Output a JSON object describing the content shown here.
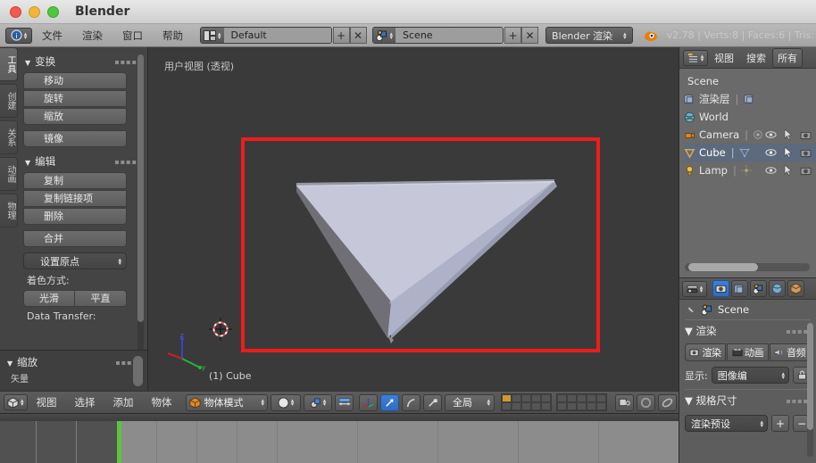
{
  "window": {
    "title": "Blender"
  },
  "topbar": {
    "menus": [
      "文件",
      "渲染",
      "窗口",
      "帮助"
    ],
    "screen_layout": "Default",
    "scene_name": "Scene",
    "engine": "Blender 渲染",
    "status": "v2.78 | Verts:8 | Faces:6 | Tris:",
    "add_label": "+",
    "remove_label": "✕"
  },
  "toolshelf": {
    "tabs": [
      {
        "label": "工具",
        "active": true
      },
      {
        "label": "创建",
        "active": false
      },
      {
        "label": "关系",
        "active": false
      },
      {
        "label": "动画",
        "active": false
      },
      {
        "label": "物理",
        "active": false
      }
    ],
    "panels": [
      {
        "title": "变换",
        "buttons": [
          "移动",
          "旋转",
          "缩放"
        ],
        "extra_buttons": [
          "镜像"
        ]
      },
      {
        "title": "编辑",
        "buttons": [
          "复制",
          "复制链接项",
          "删除"
        ],
        "extra_buttons": [
          "合并"
        ],
        "dropdown": "设置原点",
        "shading_label": "着色方式:",
        "shading_options": [
          "光滑",
          "平直"
        ],
        "data_transfer_label": "Data Transfer:"
      }
    ],
    "scale_panel": {
      "title": "缩放",
      "sub_label": "矢量"
    }
  },
  "viewport": {
    "view_info": "用户视图 (透视)",
    "object_label": "(1) Cube",
    "axis_labels": {
      "z": "z",
      "y": "y",
      "x": "x"
    },
    "annotation_color": "#ee1c1c",
    "background_color": "#3a3a3a",
    "object_color": "#c0c3d6"
  },
  "viewport_header": {
    "menus": [
      "视图",
      "选择",
      "添加",
      "物体"
    ],
    "mode": "物体模式",
    "orientation": "全局"
  },
  "outliner": {
    "menus": [
      "视图",
      "搜索"
    ],
    "filter": "所有",
    "scene_label": "Scene",
    "items": [
      {
        "name": "渲染层",
        "selected": false,
        "has_eye": false
      },
      {
        "name": "World",
        "selected": false,
        "has_eye": false
      },
      {
        "name": "Camera",
        "selected": false,
        "has_eye": true
      },
      {
        "name": "Cube",
        "selected": true,
        "has_eye": true
      },
      {
        "name": "Lamp",
        "selected": false,
        "has_eye": true
      }
    ]
  },
  "properties": {
    "breadcrumb": "Scene",
    "render_panel": {
      "title": "渲染",
      "buttons": [
        "渲染",
        "动画",
        "音频"
      ],
      "display_label": "显示:",
      "display_value": "图像编"
    },
    "dimensions_panel": {
      "title": "规格尺寸",
      "preset": "渲染预设",
      "add_label": "+",
      "remove_label": "−"
    }
  }
}
